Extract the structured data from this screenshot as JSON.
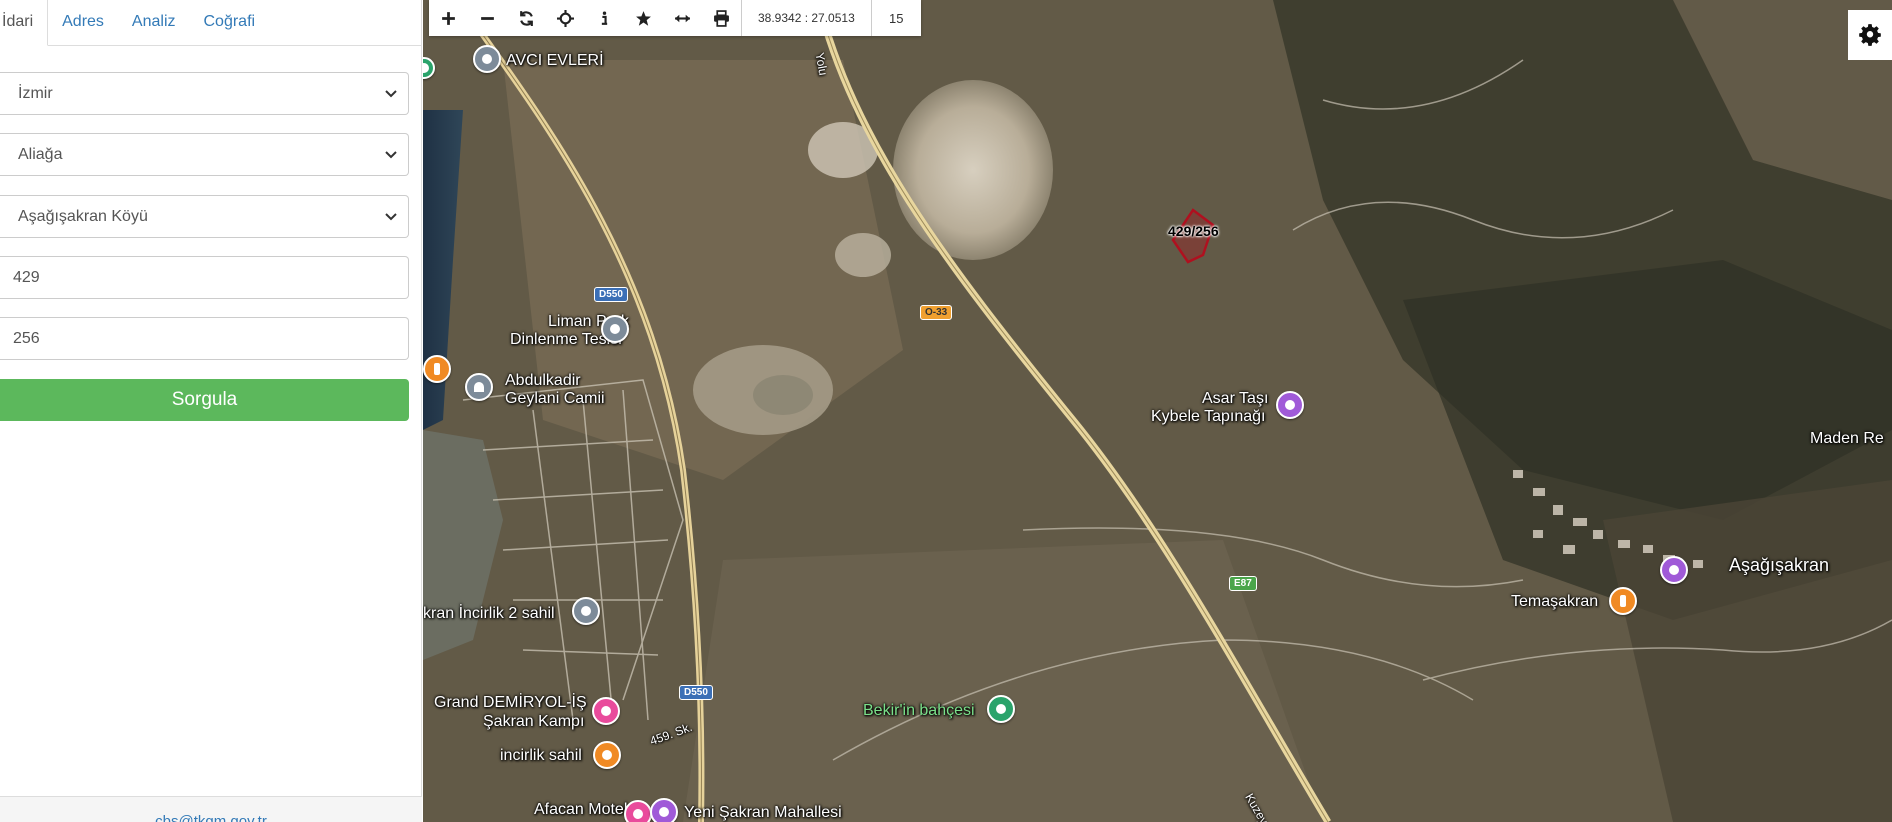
{
  "sidebar": {
    "tabs": [
      {
        "label": "İdari",
        "active": true
      },
      {
        "label": "Adres"
      },
      {
        "label": "Analiz"
      },
      {
        "label": "Coğrafi"
      }
    ],
    "province": "İzmir",
    "district": "Aliağa",
    "neighborhood": "Aşağışakran Köyü",
    "block": "429",
    "parcel": "256",
    "query_button": "Sorgula",
    "footer_email": "cbs@tkgm.gov.tr"
  },
  "map": {
    "toolbar": {
      "coordinates": "38.9342 : 27.0513",
      "zoom": "15",
      "tools": [
        "zoom-in-icon",
        "zoom-out-icon",
        "refresh-icon",
        "locate-icon",
        "info-icon",
        "star-icon",
        "measure-icon",
        "print-icon"
      ]
    },
    "parcel_label": "429/256",
    "places": {
      "avci_evleri": "AVCI EVLERİ",
      "liman_park_1": "Liman Park",
      "liman_park_2": "Dinlenme Tesisi",
      "abdulkadir_1": "Abdulkadir",
      "abdulkadir_2": "Geylani Camii",
      "asar_1": "Asar Taşı",
      "asar_2": "Kybele Tapınağı",
      "maden": "Maden Re",
      "asagisakran": "Aşağışakran",
      "temasakran": "Temaşakran",
      "incirlik2": "kran İncirlik 2 sahil",
      "grand_1": "Grand DEMİRYOL-İŞ",
      "grand_2": "Şakran Kampı",
      "incirlik_sahil": "incirlik sahil",
      "bekir": "Bekir'in bahçesi",
      "afacan": "Afacan Motel",
      "yeni_sakran": "Yeni Şakran Mahallesi",
      "road_d550_a": "D550",
      "road_d550_b": "D550",
      "road_o33": "O-33",
      "road_e87": "E87",
      "road_459": "459. Sk.",
      "road_kuzey": "Kuzey",
      "road_yolu": "Yolu"
    },
    "colors": {
      "accent_green": "#5cb85c",
      "link_blue": "#337ab7",
      "poi_gray": "#7d8b99",
      "poi_orange": "#f08a24",
      "poi_purple": "#a05ad8",
      "poi_pink": "#e94b9c",
      "poi_green": "#2aa36b"
    }
  }
}
